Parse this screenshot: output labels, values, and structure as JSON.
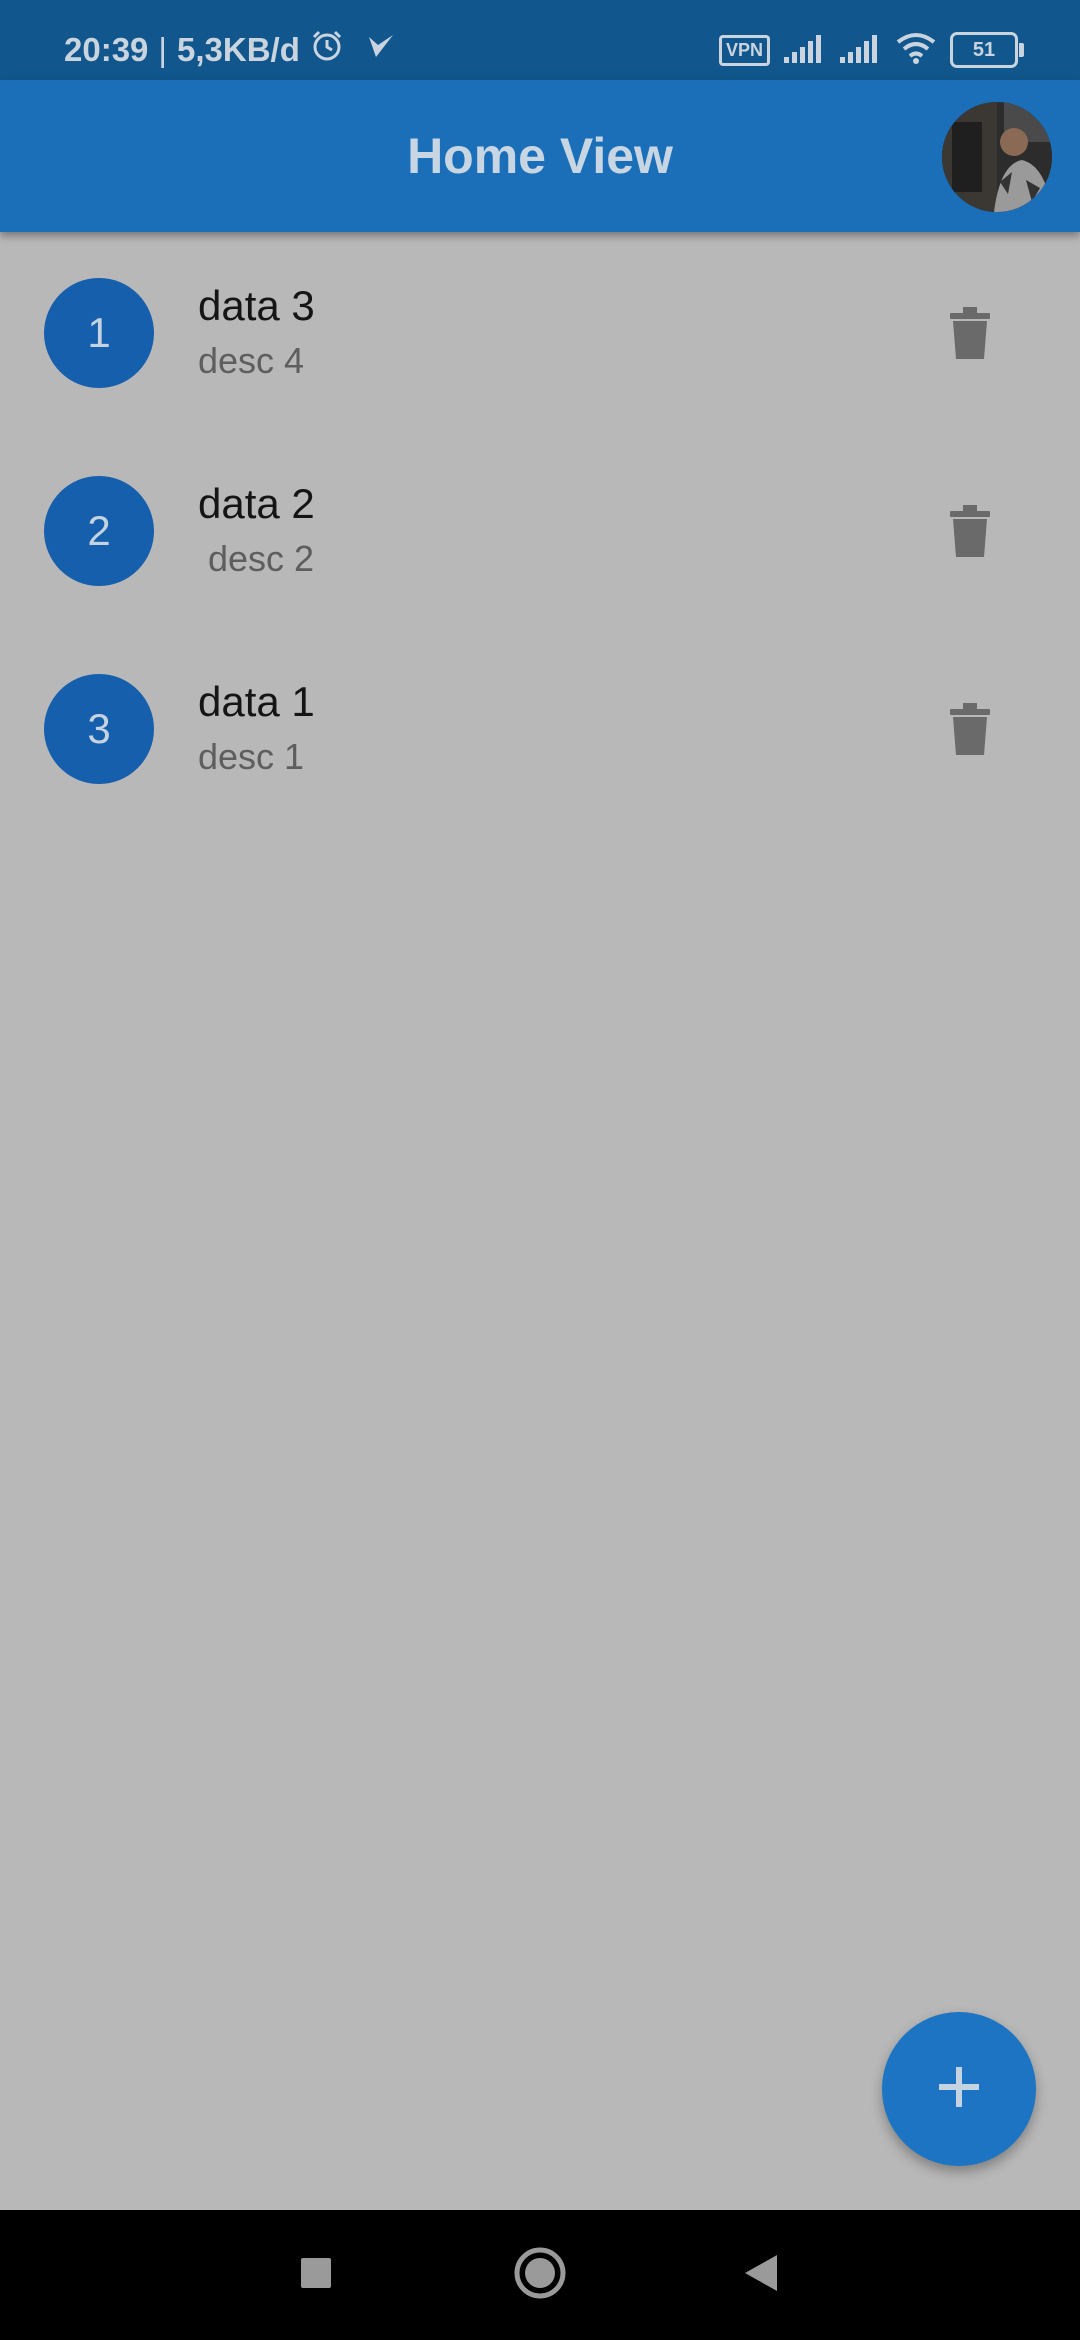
{
  "status_bar": {
    "time": "20:39",
    "separator": "|",
    "net_speed": "5,3KB/d",
    "vpn": "VPN",
    "battery": "51",
    "icons": [
      "alarm-icon",
      "check-icon",
      "signal-icon",
      "signal-icon",
      "wifi-icon",
      "battery-icon"
    ]
  },
  "app_bar": {
    "title": "Home View",
    "avatar_icon": "profile-avatar"
  },
  "items": [
    {
      "number": "1",
      "title": "data 3",
      "desc": "desc 4"
    },
    {
      "number": "2",
      "title": "data 2",
      "desc": " desc 2"
    },
    {
      "number": "3",
      "title": "data 1",
      "desc": "desc 1"
    }
  ],
  "fab": {
    "icon": "plus-icon",
    "label": "+"
  },
  "nav_bar": {
    "icons": [
      "recents-square-icon",
      "home-circle-icon",
      "back-triangle-icon"
    ]
  },
  "colors": {
    "app_bar": "#1a6fb8",
    "status_bar": "#11578d",
    "background": "#b8b8b8",
    "item_circle": "#165fad",
    "fab": "#1c74c2"
  }
}
